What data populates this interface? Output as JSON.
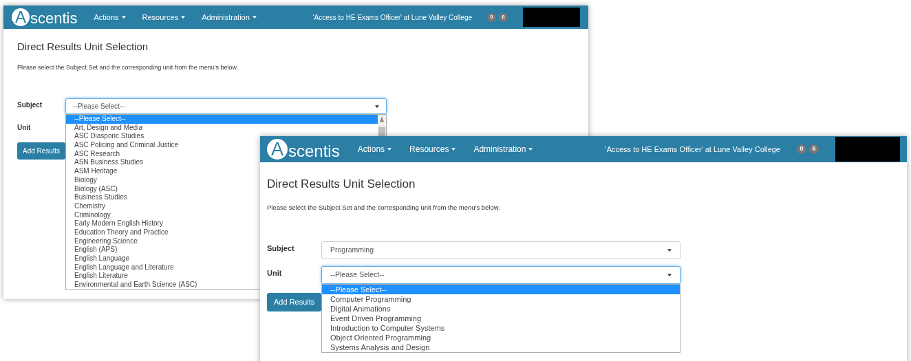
{
  "windows": [
    {
      "nav": {
        "logo_initial": "A",
        "logo_rest": "scentis",
        "menus": [
          "Actions",
          "Resources",
          "Administration"
        ],
        "role": "'Access to HE Exams Officer' at Lune Valley College",
        "badges": [
          "0",
          "6"
        ]
      },
      "title": "Direct Results Unit Selection",
      "intro": "Please select the Subject Set and the corresponding unit from the menu's below.",
      "fields": [
        {
          "label": "Subject",
          "value": "--Please Select--",
          "open": true,
          "options": [
            {
              "label": "--Please Select--",
              "selected": true
            },
            {
              "label": "Art, Design and Media",
              "selected": false
            },
            {
              "label": "ASC Diasporic Studies",
              "selected": false
            },
            {
              "label": "ASC Policing and Criminal Justice",
              "selected": false
            },
            {
              "label": "ASC Research",
              "selected": false
            },
            {
              "label": "ASN Business Studies",
              "selected": false
            },
            {
              "label": "ASM Heritage",
              "selected": false
            },
            {
              "label": "Biology",
              "selected": false
            },
            {
              "label": "Biology (ASC)",
              "selected": false
            },
            {
              "label": "Business Studies",
              "selected": false
            },
            {
              "label": "Chemistry",
              "selected": false
            },
            {
              "label": "Criminology",
              "selected": false
            },
            {
              "label": "Early Modern English History",
              "selected": false
            },
            {
              "label": "Education Theory and Practice",
              "selected": false
            },
            {
              "label": "Engineering Science",
              "selected": false
            },
            {
              "label": "English (APS)",
              "selected": false
            },
            {
              "label": "English Language",
              "selected": false
            },
            {
              "label": "English Language and Literature",
              "selected": false
            },
            {
              "label": "English Literature",
              "selected": false
            },
            {
              "label": "Environmental and Earth Science (ASC)",
              "selected": false
            }
          ]
        },
        {
          "label": "Unit"
        }
      ],
      "button": "Add Results"
    },
    {
      "nav": {
        "logo_initial": "A",
        "logo_rest": "scentis",
        "menus": [
          "Actions",
          "Resources",
          "Administration"
        ],
        "role": "'Access to HE Exams Officer' at Lune Valley College",
        "badges": [
          "0",
          "6"
        ]
      },
      "title": "Direct Results Unit Selection",
      "intro": "Please select the Subject Set and the corresponding unit from the menu's below.",
      "fields": [
        {
          "label": "Subject",
          "value": "Programming",
          "open": false
        },
        {
          "label": "Unit",
          "value": "--Please Select--",
          "open": true,
          "options": [
            {
              "label": "--Please Select--",
              "selected": true
            },
            {
              "label": "Computer Programming",
              "selected": false
            },
            {
              "label": "Digital Animations",
              "selected": false
            },
            {
              "label": "Event Driven Programming",
              "selected": false
            },
            {
              "label": "Introduction to Computer Systems",
              "selected": false
            },
            {
              "label": "Object Oriented Programming",
              "selected": false
            },
            {
              "label": "Systems Analysis and Design",
              "selected": false
            }
          ]
        }
      ],
      "button": "Add Results"
    }
  ]
}
